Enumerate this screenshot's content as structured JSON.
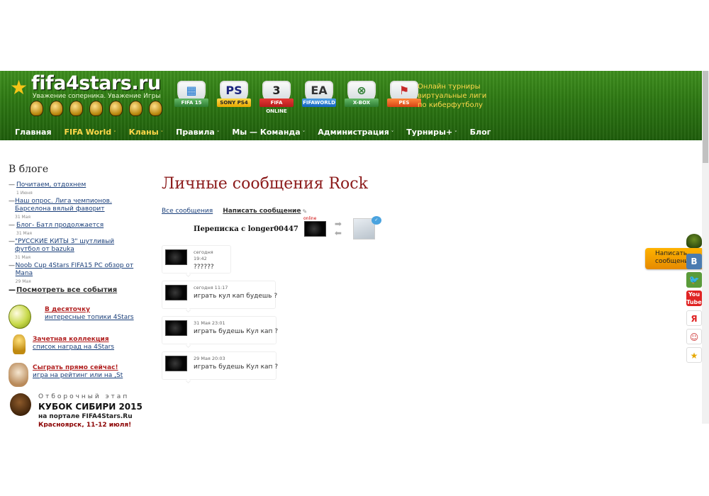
{
  "header": {
    "logo": "fifa4stars.ru",
    "tagline": "Уважение соперника. Уважение Игры",
    "promo": [
      "Онлайн турниры",
      "виртуальные лиги",
      "по киберфутболу"
    ],
    "platforms": [
      {
        "glyph": "▦",
        "label": "FIFA 15"
      },
      {
        "glyph": "PS",
        "label": "SONY PS4"
      },
      {
        "glyph": "3",
        "label": "FIFA ONLINE"
      },
      {
        "glyph": "EA",
        "label": "FIFAWORLD"
      },
      {
        "glyph": "⊗",
        "label": "X-BOX"
      },
      {
        "glyph": "⚑",
        "label": "PES"
      }
    ]
  },
  "nav": [
    {
      "label": "Главная",
      "arrow": ""
    },
    {
      "label": "FIFA World",
      "arrow": "˅"
    },
    {
      "label": "Кланы",
      "arrow": "˅"
    },
    {
      "label": "Правила",
      "arrow": "˅"
    },
    {
      "label": "Мы — Команда",
      "arrow": "˅"
    },
    {
      "label": "Администрация",
      "arrow": "˅"
    },
    {
      "label": "Турниры+",
      "arrow": "˅"
    },
    {
      "label": "Блог",
      "arrow": ""
    }
  ],
  "sidebar": {
    "blog_title": "В блоге",
    "items": [
      {
        "title": "Почитаем, отдохнем",
        "date": "1 Июня"
      },
      {
        "title": "Наш опрос. Лига чемпионов. Барселона вялый фаворит",
        "date": "31 Мая"
      },
      {
        "title": "Блог- Батл продолжается",
        "date": "31 Мая"
      },
      {
        "title": "\"РУССКИЕ КИТЫ 3\" шутливый футбол от bazuka",
        "date": "31 Мая"
      },
      {
        "title": "Noob Cup 4Stars FIFA15 PC обзор от Mana",
        "date": "29 Мая"
      }
    ],
    "all_events": "Посмотреть все события",
    "promos": [
      {
        "title": "В десяточку",
        "sub": "интересные топики 4Stars"
      },
      {
        "title": "Зачетная коллекция",
        "sub": "список наград на 4Stars"
      },
      {
        "title": "Сыграть прямо сейчас!",
        "sub": "игра на рейтинг или на ,St"
      }
    ],
    "siberia": {
      "pre": "Отборочный этап",
      "main": "КУБОК СИБИРИ 2015",
      "sub": "на портале FIFA4Stars.Ru",
      "sub2": "Красноярск, 11-12 июля!"
    }
  },
  "main": {
    "title": "Личные сообщения Rock",
    "links": {
      "all": "Все сообщения",
      "write": "Написать сообщение"
    },
    "thread_label": "Переписка с longer00447",
    "online": "online",
    "messages": [
      {
        "when": "сегодня 19:42",
        "text": "??????"
      },
      {
        "when": "сегодня 11:17",
        "text": "играть кул кап будешь ?"
      },
      {
        "when": "31 Мая 23:01",
        "text": "играть будешь Кул кап ?"
      },
      {
        "when": "29 Мая 20:03",
        "text": "играть будешь Кул кап ?"
      }
    ]
  },
  "right": {
    "write_tab": [
      "Написать",
      "сообщени"
    ],
    "social": [
      "В",
      "🐦",
      "You Tube",
      "Я",
      "☺",
      "★"
    ]
  }
}
